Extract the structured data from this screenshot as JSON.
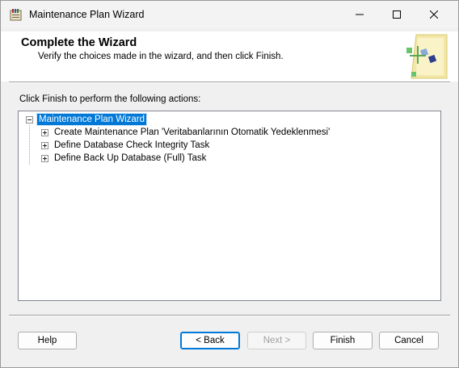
{
  "window": {
    "title": "Maintenance Plan Wizard",
    "icon": "wizard-app-icon"
  },
  "header": {
    "title": "Complete the Wizard",
    "subtitle": "Verify the choices made in the wizard, and then click Finish."
  },
  "prompt": "Click Finish to perform the following actions:",
  "tree": {
    "root": {
      "label": "Maintenance Plan Wizard",
      "expanded": true,
      "selected": true
    },
    "children": [
      {
        "label": "Create Maintenance Plan 'Veritabanlarının Otomatik Yedeklenmesi'",
        "expanded": false
      },
      {
        "label": "Define Database Check Integrity Task",
        "expanded": false
      },
      {
        "label": "Define Back Up Database (Full) Task",
        "expanded": false
      }
    ]
  },
  "buttons": {
    "help": "Help",
    "back": "< Back",
    "next": "Next >",
    "finish": "Finish",
    "cancel": "Cancel"
  },
  "colors": {
    "selection": "#0078d7",
    "window_bg": "#f0f0f0"
  }
}
